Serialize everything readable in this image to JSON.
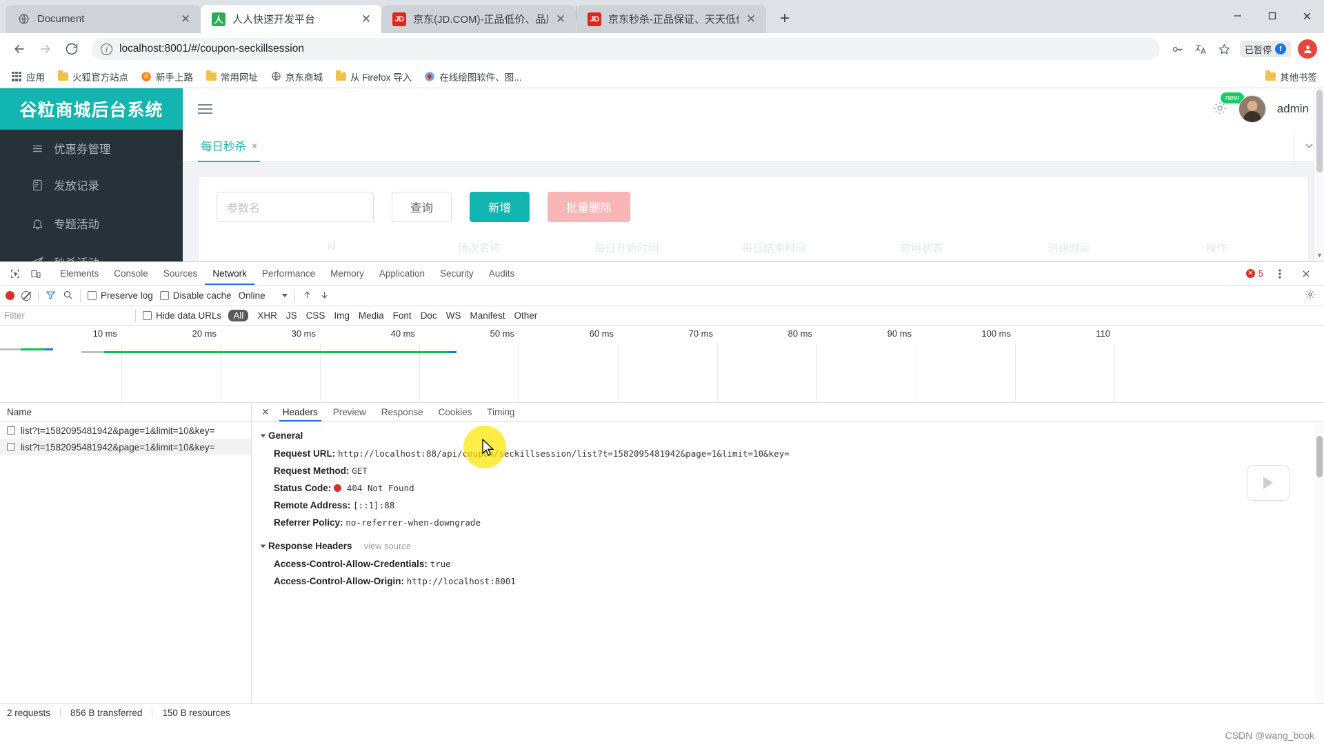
{
  "browser": {
    "tabs": [
      {
        "title": "Document",
        "favicon": "globe-icon",
        "active": false
      },
      {
        "title": "人人快速开发平台",
        "favicon": "renren-icon",
        "active": true
      },
      {
        "title": "京东(JD.COM)-正品低价、品质保",
        "favicon": "jd-icon",
        "active": false
      },
      {
        "title": "京东秒杀-正品保证、天天低价、",
        "favicon": "jd-icon",
        "active": false
      }
    ],
    "new_tab_label": "+",
    "window_controls": {
      "minimize": "minimize-icon",
      "maximize": "maximize-icon",
      "close": "close-icon"
    },
    "toolbar": {
      "back": "back-arrow-icon",
      "forward": "forward-arrow-icon",
      "reload": "reload-icon",
      "site_info": "info-icon",
      "url": "localhost:8001/#/coupon-seckillsession",
      "key_icon": "key-icon",
      "translate_icon": "translate-icon",
      "bookmark_icon": "star-icon",
      "paused_badge": "已暂停",
      "paused_initial": "f",
      "profile_initial": "",
      "profile_icon": "profile-avatar-icon"
    },
    "bookmarks": [
      {
        "label": "应用",
        "icon": "apps-grid-icon"
      },
      {
        "label": "火狐官方站点",
        "icon": "folder-icon"
      },
      {
        "label": "新手上路",
        "icon": "firefox-icon"
      },
      {
        "label": "常用网址",
        "icon": "folder-icon"
      },
      {
        "label": "京东商城",
        "icon": "globe-icon"
      },
      {
        "label": "从 Firefox 导入",
        "icon": "folder-icon"
      },
      {
        "label": "在线绘图软件、图...",
        "icon": "drawio-icon"
      }
    ],
    "bookmarks_overflow": {
      "label": "其他书签",
      "icon": "folder-icon"
    }
  },
  "app": {
    "logo": "谷粒商城后台系统",
    "sidebar": [
      {
        "label": "优惠券管理",
        "icon": "list-icon"
      },
      {
        "label": "发放记录",
        "icon": "record-icon"
      },
      {
        "label": "专题活动",
        "icon": "bell-icon"
      },
      {
        "label": "秒杀活动",
        "icon": "send-icon"
      }
    ],
    "header": {
      "menu_toggle": "hamburger-icon",
      "gear": "gear-icon",
      "new_badge": "new",
      "avatar": "user-avatar-icon",
      "username": "admin"
    },
    "page_tabs": [
      {
        "label": "每日秒杀",
        "close": "×",
        "active": true
      }
    ],
    "collapse_icon": "chevron-down-icon",
    "toolbar": {
      "search_placeholder": "参数名",
      "search_value": "",
      "query_label": "查询",
      "add_label": "新增",
      "batch_delete_label": "批量删除"
    },
    "table_headers": [
      "",
      "id",
      "场次名称",
      "每日开始时间",
      "每日结束时间",
      "启用状态",
      "创建时间",
      "操作"
    ],
    "accent_color": "#13b5b1"
  },
  "devtools": {
    "panels": [
      "Elements",
      "Console",
      "Sources",
      "Network",
      "Performance",
      "Memory",
      "Application",
      "Security",
      "Audits"
    ],
    "active_panel": "Network",
    "inspect_icon": "inspect-icon",
    "device_icon": "device-toolbar-icon",
    "error_count": "5",
    "more_icon": "more-vertical-icon",
    "close_icon": "close-icon",
    "settings_icon": "gear-icon",
    "controls": {
      "record": "record-icon",
      "clear": "clear-icon",
      "filter": "filter-icon",
      "search": "search-icon",
      "preserve_log": "Preserve log",
      "disable_cache": "Disable cache",
      "throttle": "Online",
      "import": "import-icon",
      "export": "export-icon"
    },
    "filterbar": {
      "filter_placeholder": "Filter",
      "hide_data_urls": "Hide data URLs",
      "types": [
        "All",
        "XHR",
        "JS",
        "CSS",
        "Img",
        "Media",
        "Font",
        "Doc",
        "WS",
        "Manifest",
        "Other"
      ],
      "active_type": "All"
    },
    "timeline_ticks": [
      "10 ms",
      "20 ms",
      "30 ms",
      "40 ms",
      "50 ms",
      "60 ms",
      "70 ms",
      "80 ms",
      "90 ms",
      "100 ms",
      "110"
    ],
    "requests_header": "Name",
    "requests": [
      {
        "name": "list?t=1582095481942&page=1&limit=10&key=",
        "selected": false
      },
      {
        "name": "list?t=1582095481942&page=1&limit=10&key=",
        "selected": true
      }
    ],
    "detail_tabs": [
      "Headers",
      "Preview",
      "Response",
      "Cookies",
      "Timing"
    ],
    "active_detail_tab": "Headers",
    "general": {
      "section_title": "General",
      "request_url_key": "Request URL:",
      "request_url_value": "http://localhost:88/api/coupon/seckillsession/list?t=1582095481942&page=1&limit=10&key=",
      "request_method_key": "Request Method:",
      "request_method_value": "GET",
      "status_code_key": "Status Code:",
      "status_code_value": "404 Not Found",
      "remote_address_key": "Remote Address:",
      "remote_address_value": "[::1]:88",
      "referrer_policy_key": "Referrer Policy:",
      "referrer_policy_value": "no-referrer-when-downgrade"
    },
    "response_headers": {
      "section_title": "Response Headers",
      "view_source": "view source",
      "rows": [
        {
          "key": "Access-Control-Allow-Credentials:",
          "value": "true"
        },
        {
          "key": "Access-Control-Allow-Origin:",
          "value": "http://localhost:8001"
        }
      ]
    },
    "status_bar": {
      "requests": "2 requests",
      "transferred": "856 B transferred",
      "resources": "150 B resources"
    }
  },
  "watermark": "CSDN @wang_book"
}
